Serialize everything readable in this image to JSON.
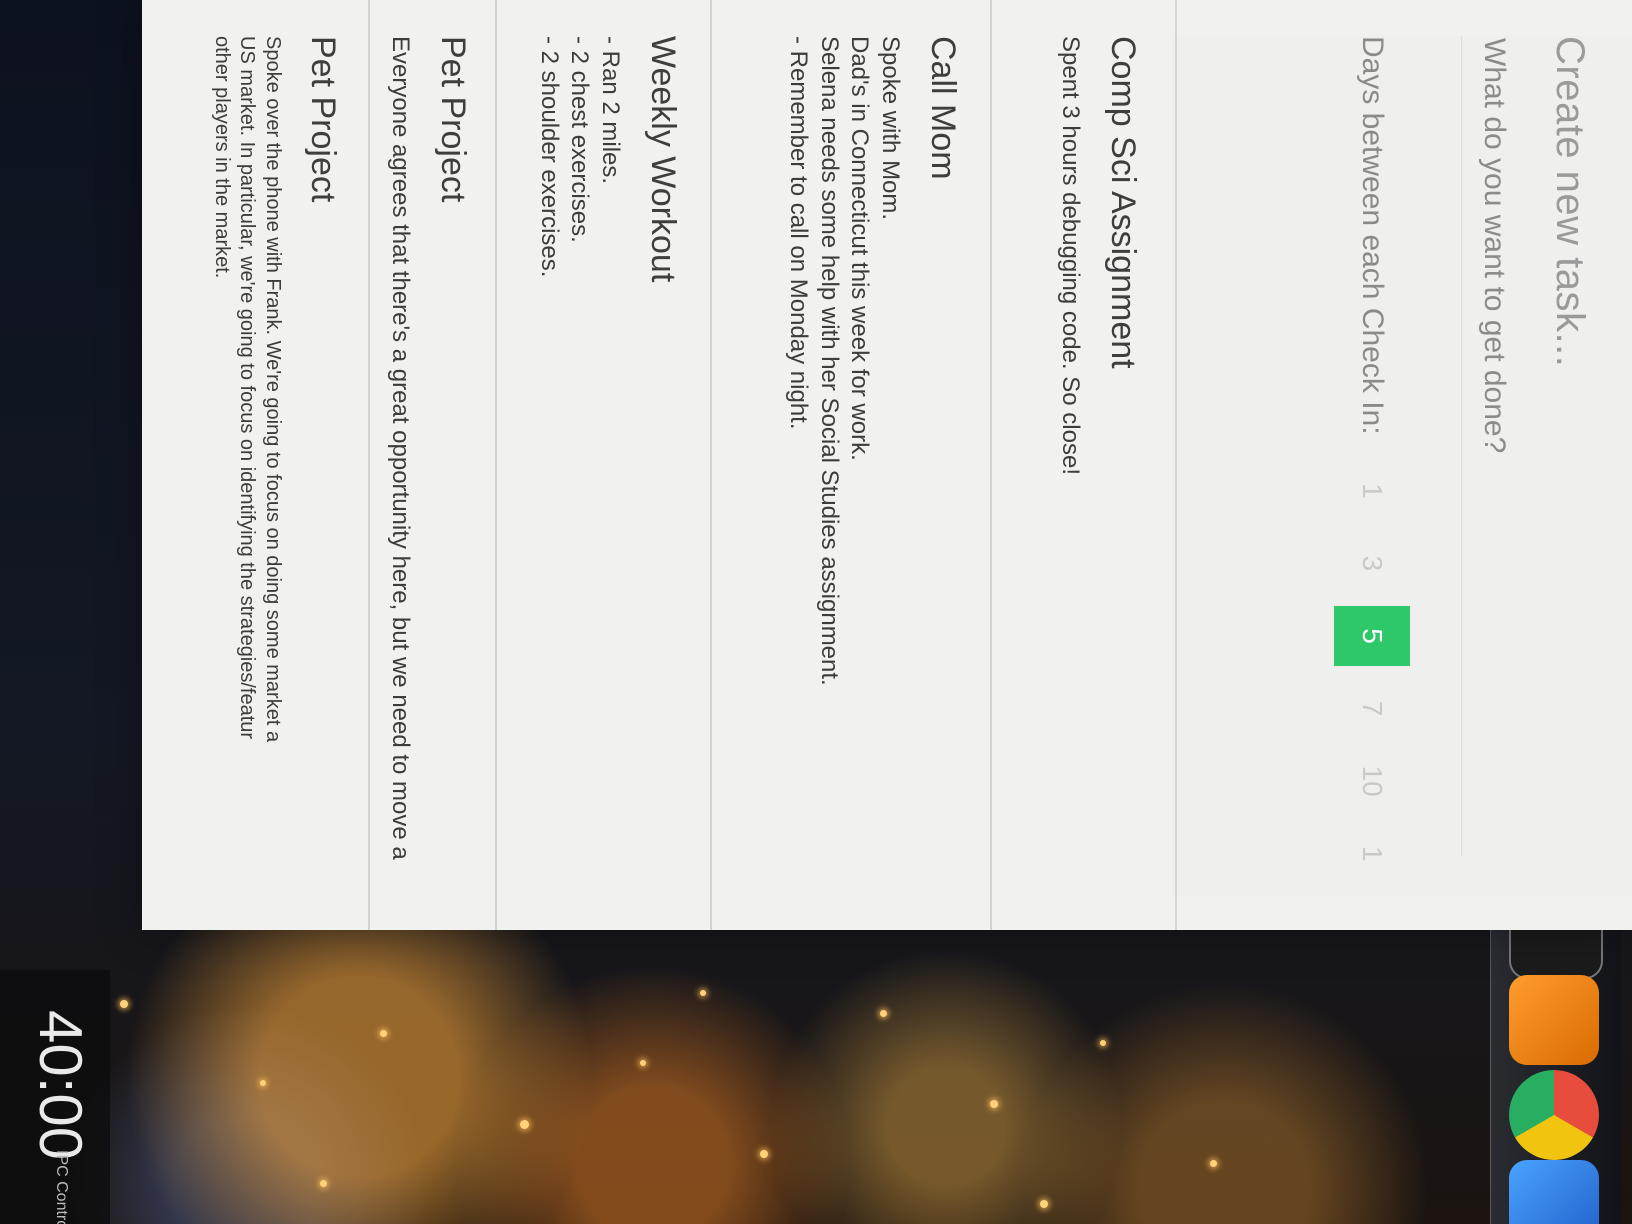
{
  "create": {
    "title": "Create new task...",
    "placeholder": "What do you want to get done?",
    "days_label": "Days between each Check In:",
    "day_options": [
      "1",
      "3",
      "5",
      "7",
      "10",
      "1"
    ],
    "selected": "5"
  },
  "tasks": [
    {
      "title": "Comp Sci Assignment",
      "body": "Spent 3 hours debugging code. So close!"
    },
    {
      "title": "Call Mom",
      "body": "Spoke with Mom.\nDad's in Connecticut this week for work.\nSelena needs some help with her Social Studies assignment.\n - Remember to call on Monday night."
    },
    {
      "title": "Weekly Workout",
      "body": "- Ran 2 miles.\n- 2 chest exercises.\n- 2 shoulder exercises."
    },
    {
      "title": "Pet Project",
      "body": "Everyone agrees that there's a great opportunity here, but we need to move a"
    },
    {
      "title": "Pet Project",
      "body": "Spoke over the phone with Frank. We're going to focus on doing some market a\nUS market. In particular, we're going to focus on identifying the strategies/featur\nother players in the market."
    }
  ],
  "clock": {
    "time": "40:00",
    "label": "IPC Control"
  },
  "dock": {
    "icons": [
      "finder-icon",
      "launchpad-icon",
      "system-preferences-icon",
      "activity-monitor-icon",
      "terminal-icon",
      "app-store-icon",
      "sublime-text-icon",
      "chrome-icon",
      "word-icon"
    ]
  }
}
